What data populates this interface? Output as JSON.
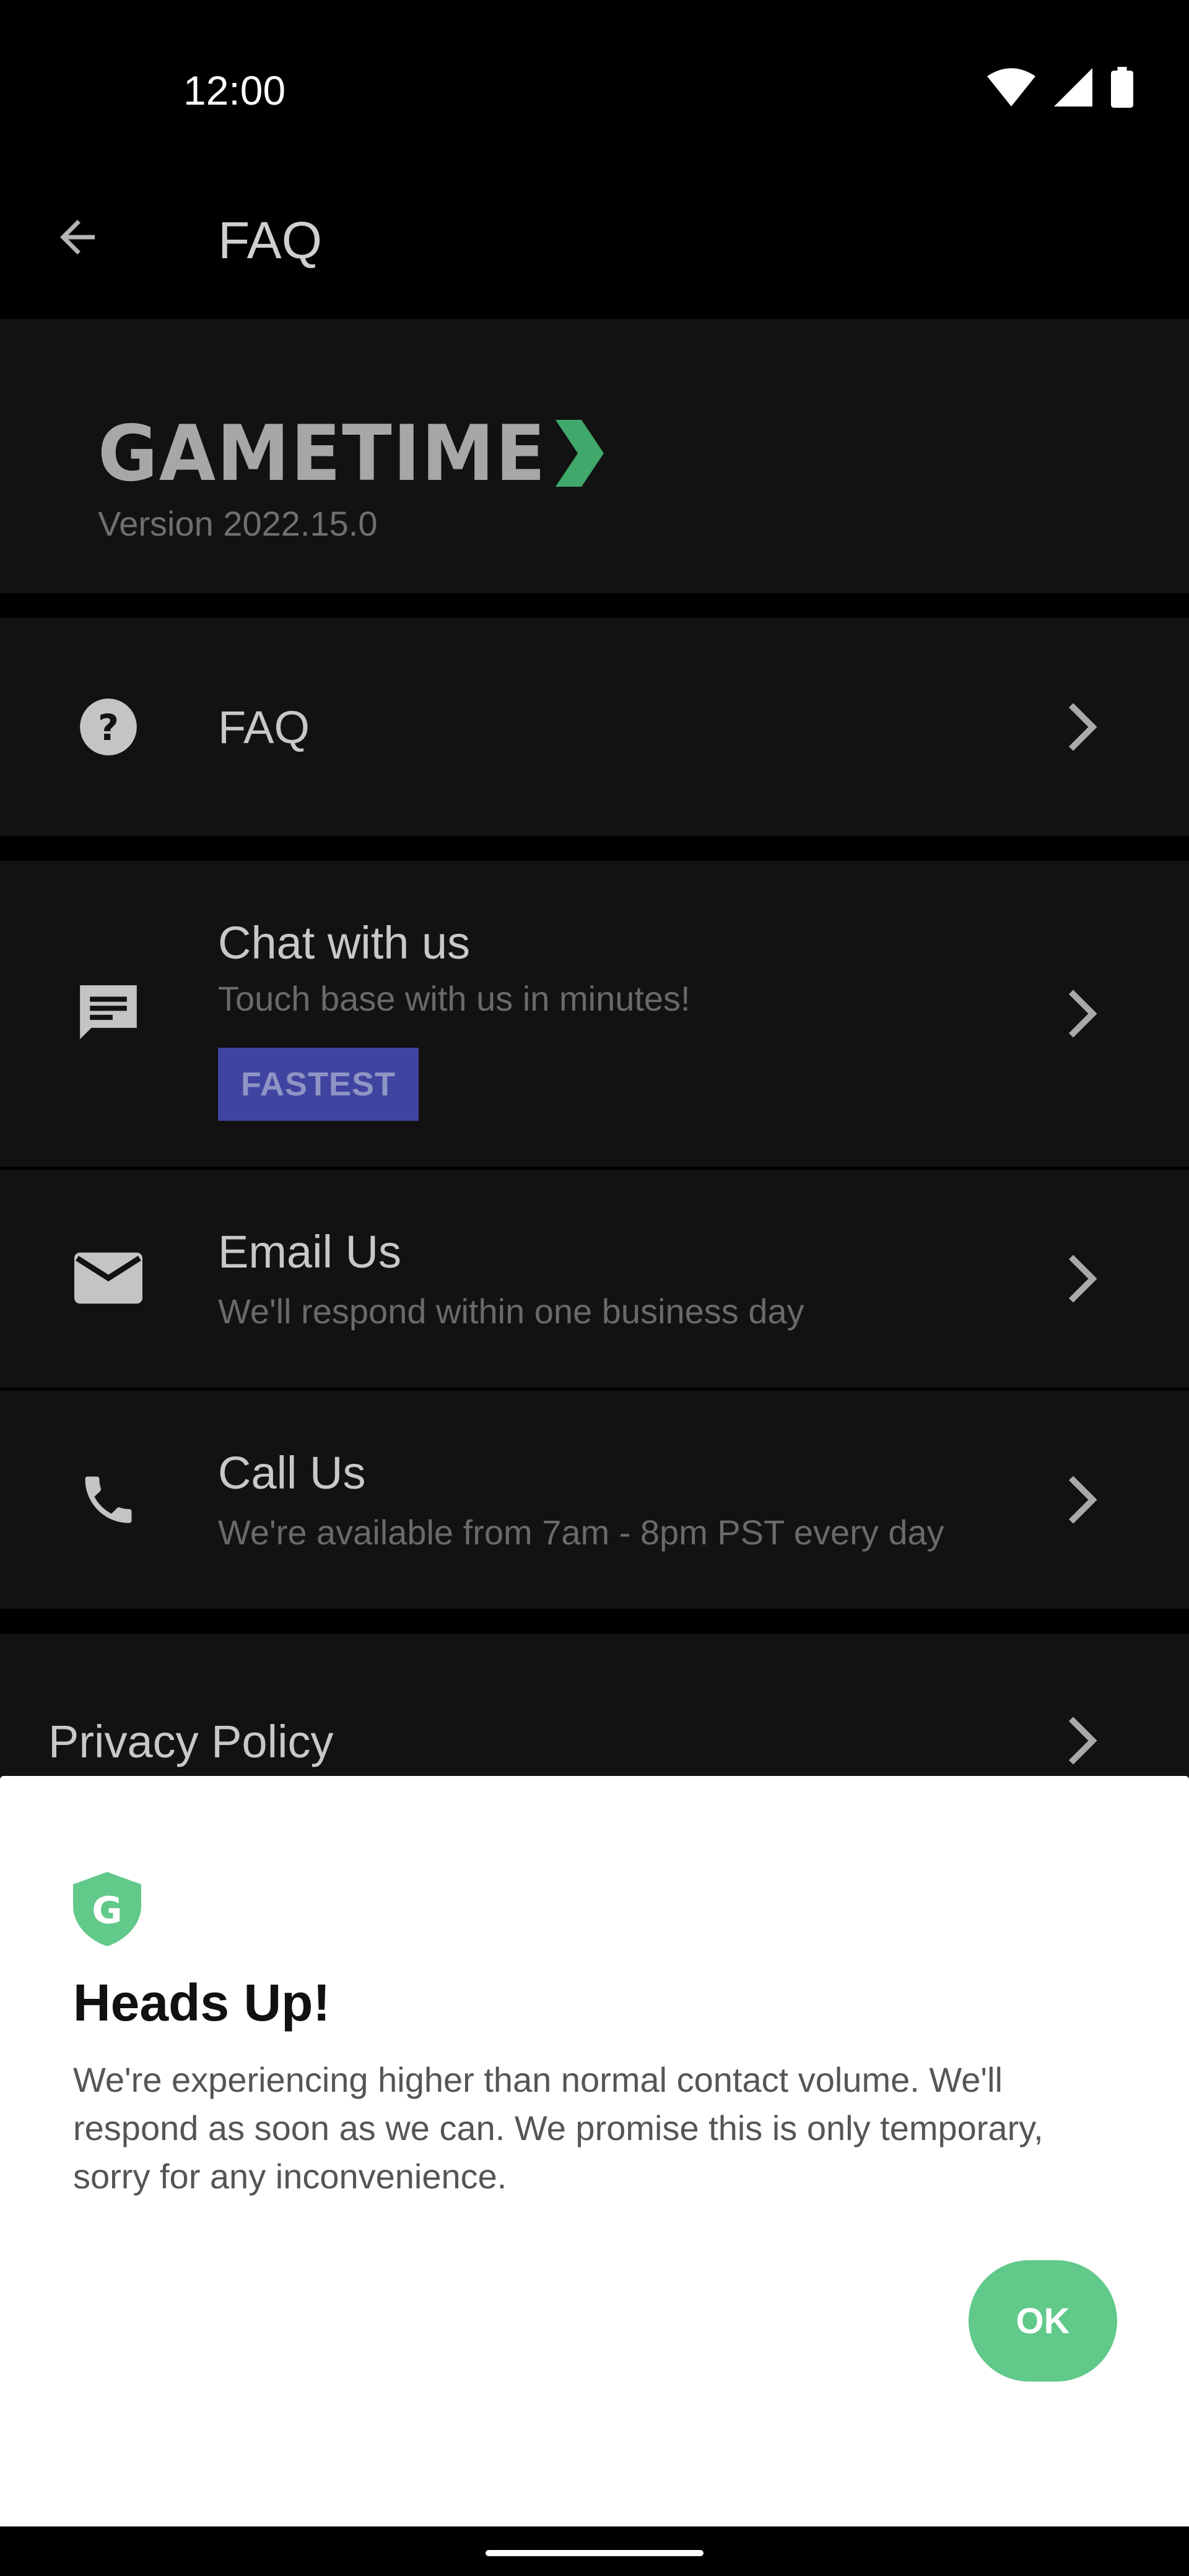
{
  "status_bar": {
    "time": "12:00",
    "icons": [
      "wifi-icon",
      "signal-icon",
      "battery-icon"
    ]
  },
  "app_bar": {
    "title": "FAQ",
    "back_icon": "arrow-back-icon"
  },
  "brand": {
    "logo_text": "GAMETIME",
    "version": "Version 2022.15.0",
    "accent_color": "#3fa86a"
  },
  "menu": {
    "faq": {
      "icon": "help-circle-icon",
      "label": "FAQ"
    },
    "chat": {
      "icon": "chat-bubble-icon",
      "label": "Chat with us",
      "subtitle": "Touch base with us in minutes!",
      "badge": "FASTEST"
    },
    "email": {
      "icon": "mail-icon",
      "label": "Email Us",
      "subtitle": "We'll respond within one business day"
    },
    "call": {
      "icon": "phone-icon",
      "label": "Call Us",
      "subtitle": "We're available from 7am - 8pm PST every day"
    },
    "privacy": {
      "label": "Privacy Policy"
    }
  },
  "dialog": {
    "icon": "shield-g-icon",
    "title": "Heads Up!",
    "body": "We're experiencing higher than normal contact volume. We'll respond as soon as we can. We promise this is only temporary, sorry for any inconvenience.",
    "ok_label": "OK",
    "ok_color": "#61c98a"
  }
}
